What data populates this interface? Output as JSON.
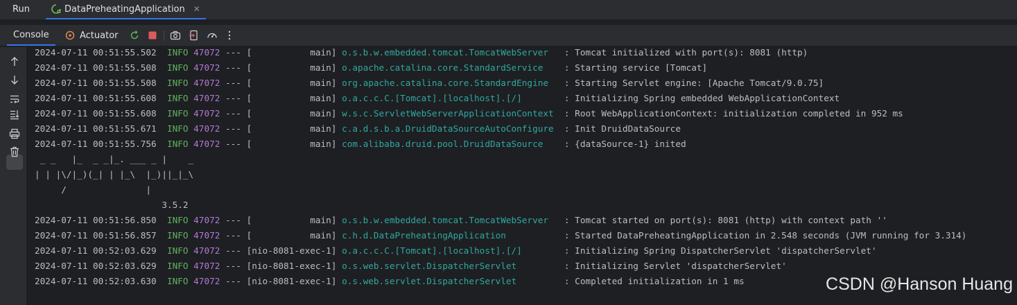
{
  "tool_window": {
    "title": "Run",
    "tab": {
      "label": "DataPreheatingApplication",
      "close": "✕"
    }
  },
  "toolbar": {
    "console_label": "Console",
    "actuator_label": "Actuator"
  },
  "colors": {
    "background": "#1e1f22",
    "panel": "#2b2d30",
    "info_level": "#5fb35f",
    "pid": "#b179d4",
    "logger": "#2fa8a1",
    "accent": "#3574f0"
  },
  "log_lines": [
    {
      "time": "2024-07-11 00:51:55.502",
      "level": "INFO",
      "pid": "47072",
      "sep": "---",
      "thread": "[           main]",
      "logger": "o.s.b.w.embedded.tomcat.TomcatWebServer  ",
      "msg": ": Tomcat initialized with port(s): 8081 (http)"
    },
    {
      "time": "2024-07-11 00:51:55.508",
      "level": "INFO",
      "pid": "47072",
      "sep": "---",
      "thread": "[           main]",
      "logger": "o.apache.catalina.core.StandardService   ",
      "msg": ": Starting service [Tomcat]"
    },
    {
      "time": "2024-07-11 00:51:55.508",
      "level": "INFO",
      "pid": "47072",
      "sep": "---",
      "thread": "[           main]",
      "logger": "org.apache.catalina.core.StandardEngine  ",
      "msg": ": Starting Servlet engine: [Apache Tomcat/9.0.75]"
    },
    {
      "time": "2024-07-11 00:51:55.608",
      "level": "INFO",
      "pid": "47072",
      "sep": "---",
      "thread": "[           main]",
      "logger": "o.a.c.c.C.[Tomcat].[localhost].[/]       ",
      "msg": ": Initializing Spring embedded WebApplicationContext"
    },
    {
      "time": "2024-07-11 00:51:55.608",
      "level": "INFO",
      "pid": "47072",
      "sep": "---",
      "thread": "[           main]",
      "logger": "w.s.c.ServletWebServerApplicationContext ",
      "msg": ": Root WebApplicationContext: initialization completed in 952 ms"
    },
    {
      "time": "2024-07-11 00:51:55.671",
      "level": "INFO",
      "pid": "47072",
      "sep": "---",
      "thread": "[           main]",
      "logger": "c.a.d.s.b.a.DruidDataSourceAutoConfigure ",
      "msg": ": Init DruidDataSource"
    },
    {
      "time": "2024-07-11 00:51:55.756",
      "level": "INFO",
      "pid": "47072",
      "sep": "---",
      "thread": "[           main]",
      "logger": "com.alibaba.druid.pool.DruidDataSource   ",
      "msg": ": {dataSource-1} inited"
    }
  ],
  "banner": [
    " _ _   |_  _ _|_. ___ _ |    _",
    "| | |\\/|_)(_| | |_\\  |_)||_|_\\",
    "     /               |",
    "                        3.5.2"
  ],
  "log_lines_after": [
    {
      "time": "2024-07-11 00:51:56.850",
      "level": "INFO",
      "pid": "47072",
      "sep": "---",
      "thread": "[           main]",
      "logger": "o.s.b.w.embedded.tomcat.TomcatWebServer  ",
      "msg": ": Tomcat started on port(s): 8081 (http) with context path ''"
    },
    {
      "time": "2024-07-11 00:51:56.857",
      "level": "INFO",
      "pid": "47072",
      "sep": "---",
      "thread": "[           main]",
      "logger": "c.h.d.DataPreheatingApplication          ",
      "msg": ": Started DataPreheatingApplication in 2.548 seconds (JVM running for 3.314)"
    },
    {
      "time": "2024-07-11 00:52:03.629",
      "level": "INFO",
      "pid": "47072",
      "sep": "---",
      "thread": "[nio-8081-exec-1]",
      "logger": "o.a.c.c.C.[Tomcat].[localhost].[/]       ",
      "msg": ": Initializing Spring DispatcherServlet 'dispatcherServlet'"
    },
    {
      "time": "2024-07-11 00:52:03.629",
      "level": "INFO",
      "pid": "47072",
      "sep": "---",
      "thread": "[nio-8081-exec-1]",
      "logger": "o.s.web.servlet.DispatcherServlet        ",
      "msg": ": Initializing Servlet 'dispatcherServlet'"
    },
    {
      "time": "2024-07-11 00:52:03.630",
      "level": "INFO",
      "pid": "47072",
      "sep": "---",
      "thread": "[nio-8081-exec-1]",
      "logger": "o.s.web.servlet.DispatcherServlet        ",
      "msg": ": Completed initialization in 1 ms"
    }
  ],
  "watermark": "CSDN @Hanson Huang"
}
